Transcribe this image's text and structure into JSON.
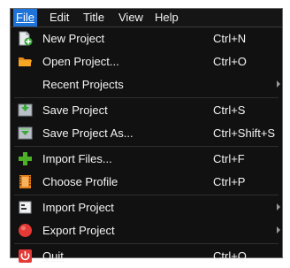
{
  "menubar": {
    "file": "File",
    "edit": "Edit",
    "title": "Title",
    "view": "View",
    "help": "Help"
  },
  "menu": {
    "new_project": {
      "label": "New Project",
      "shortcut": "Ctrl+N",
      "icon": "new-project-icon"
    },
    "open_project": {
      "label": "Open Project...",
      "shortcut": "Ctrl+O",
      "icon": "folder-icon"
    },
    "recent_projects": {
      "label": "Recent Projects",
      "shortcut": "",
      "icon": ""
    },
    "save_project": {
      "label": "Save Project",
      "shortcut": "Ctrl+S",
      "icon": "save-icon"
    },
    "save_project_as": {
      "label": "Save Project As...",
      "shortcut": "Ctrl+Shift+S",
      "icon": "save-as-icon"
    },
    "import_files": {
      "label": "Import Files...",
      "shortcut": "Ctrl+F",
      "icon": "plus-icon"
    },
    "choose_profile": {
      "label": "Choose Profile",
      "shortcut": "Ctrl+P",
      "icon": "film-icon"
    },
    "import_project": {
      "label": "Import Project",
      "shortcut": "",
      "icon": "import-icon"
    },
    "export_project": {
      "label": "Export Project",
      "shortcut": "",
      "icon": "red-circle-icon"
    },
    "quit": {
      "label": "Quit",
      "shortcut": "Ctrl+Q",
      "icon": "power-icon"
    }
  },
  "colors": {
    "menu_bg": "#111111",
    "highlight": "#1e73d8",
    "text": "#f4f4f4"
  }
}
